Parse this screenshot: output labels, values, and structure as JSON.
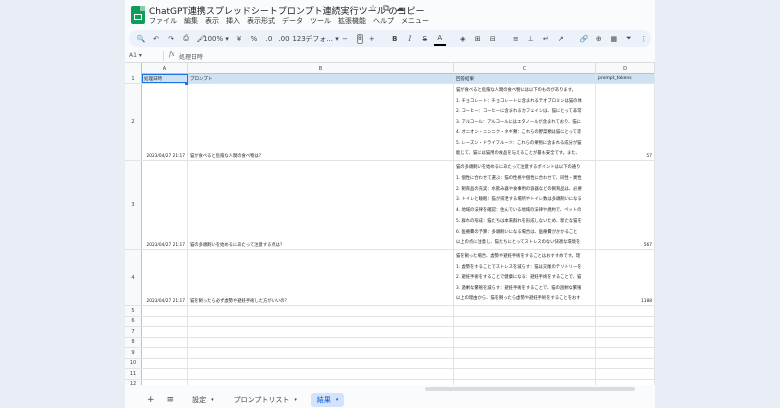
{
  "app": {
    "title": "ChatGPT連携スプレッドシートプロンプト連続実行ツール のコピー",
    "title_icons": [
      "☆",
      "⧉",
      "☁"
    ],
    "menus": [
      "ファイル",
      "編集",
      "表示",
      "挿入",
      "表示形式",
      "データ",
      "ツール",
      "拡張機能",
      "ヘルプ",
      "メニュー"
    ]
  },
  "toolbar": {
    "search": "🔍",
    "undo": "↶",
    "redo": "↷",
    "print": "⎙",
    "paint": "🖌",
    "zoom": "100%",
    "zoom_caret": "▾",
    "currency": "¥",
    "percent": "%",
    "dec_minus": ".0",
    "dec_plus": ".00",
    "number_format": "123",
    "font": "デフォ...",
    "font_caret": "▾",
    "size_minus": "−",
    "font_size": "8",
    "size_plus": "+",
    "bold": "B",
    "italic": "I",
    "strike": "S",
    "text_color": "A",
    "fill": "◈",
    "borders": "⊞",
    "merge": "⊟",
    "align": "≡",
    "valign": "⊥",
    "wrap": "↵",
    "rotate": "↗",
    "link": "🔗",
    "comment": "⊕",
    "chart": "▦",
    "filter": "⏷",
    "more": "⋮"
  },
  "formula_bar": {
    "cell_ref": "A1",
    "cell_ref_caret": "▾",
    "fx": "fx",
    "value": "処理日時"
  },
  "columns": [
    "A",
    "B",
    "C",
    "D",
    "E",
    "F"
  ],
  "rows": {
    "header": {
      "num": "1",
      "cells": [
        "処理日時",
        "プロンプト",
        "回答結果",
        "prompt_tokens",
        "completion_tokens",
        "total_tokens"
      ]
    },
    "data": [
      {
        "num": "2",
        "date": "2023/04/27 21:17",
        "prompt": "猫が食べると危険な人間の食べ物は？",
        "answer_lines": [
          "猫が食べると危険な人間の食べ物には以下のものがあります。",
          "1. チョコレート：チョコレートに含まれるテオブロミンは猫の体",
          "2. コーヒー：コーヒーに含まれるカフェインは、猫にとって非常",
          "3. アルコール：アルコールにはエタノールが含まれており、猫に",
          "4. オニオン・ニンニク・ネギ類：これらの野菜類は猫にとって赤",
          "5. レーズン・ドライフルーツ：これらの果物に含まれる成分が猫",
          "能じて、猫には猫用の食品を与えることが最も安全です。また、"
        ],
        "prompt_tokens": "57",
        "completion_tokens": "477",
        "total_tokens": "534"
      },
      {
        "num": "3",
        "date": "2023/04/27 21:17",
        "prompt": "猫の多頭飼いを始めるにあたって注意する点は？",
        "answer_lines": [
          "猫の多頭飼いを始めるにあたって注意するポイントは以下の通り",
          "1. 個性に合わせて選ぶ：猫の性格や個性に合わせて、同性・異性",
          "2. 飼育品の充実：水飲み器や食事用の容器などの飼育品は、必要",
          "3. トイレと睡眠：猫が排泄する場所やトイレ数は多頭飼いになる",
          "4. 地域の法律を確認：住んでいる地域の法律や規約で、ペットの",
          "5. 群れの形成：猫たちは本来群れを形成しないため、新たな猫を",
          "6. 医療費の予算：多頭飼いになる場合は、医療費がかかること",
          "以上の点に注意し、猫たちにとってストレスのない快適な環境を"
        ],
        "prompt_tokens": "567",
        "completion_tokens": "579",
        "total_tokens": "1146"
      },
      {
        "num": "4",
        "date": "2023/04/27 21:17",
        "prompt": "猫を飼ったら必ず虚勢や避妊手術した方がいいの？",
        "answer_lines": [
          "猫を飼った場合、虚勢や避妊手術をすることはおすすめです。理",
          "1. 虚勢をすることでストレスを減らす：猫は交尾のテリトリーを",
          "2. 避妊手術をすることで健康になる：避妊手術をすることで、猫",
          "3. 過剰な繁殖を減らす：避妊手術をすることで、猫の過剰な繁殖",
          "以上の理由から、猫を飼ったら虚勢や避妊手術をすることをおす"
        ],
        "prompt_tokens": "1188",
        "completion_tokens": "487",
        "total_tokens": "1675"
      }
    ],
    "empty": [
      "5",
      "6",
      "7",
      "8",
      "9",
      "10",
      "11",
      "12",
      "13",
      "14"
    ]
  },
  "sheetbar": {
    "add": "+",
    "all_sheets": "≡",
    "tabs": [
      {
        "label": "設定",
        "active": false
      },
      {
        "label": "プロンプトリスト",
        "active": false
      },
      {
        "label": "結果",
        "active": true
      }
    ],
    "caret": "▾"
  }
}
